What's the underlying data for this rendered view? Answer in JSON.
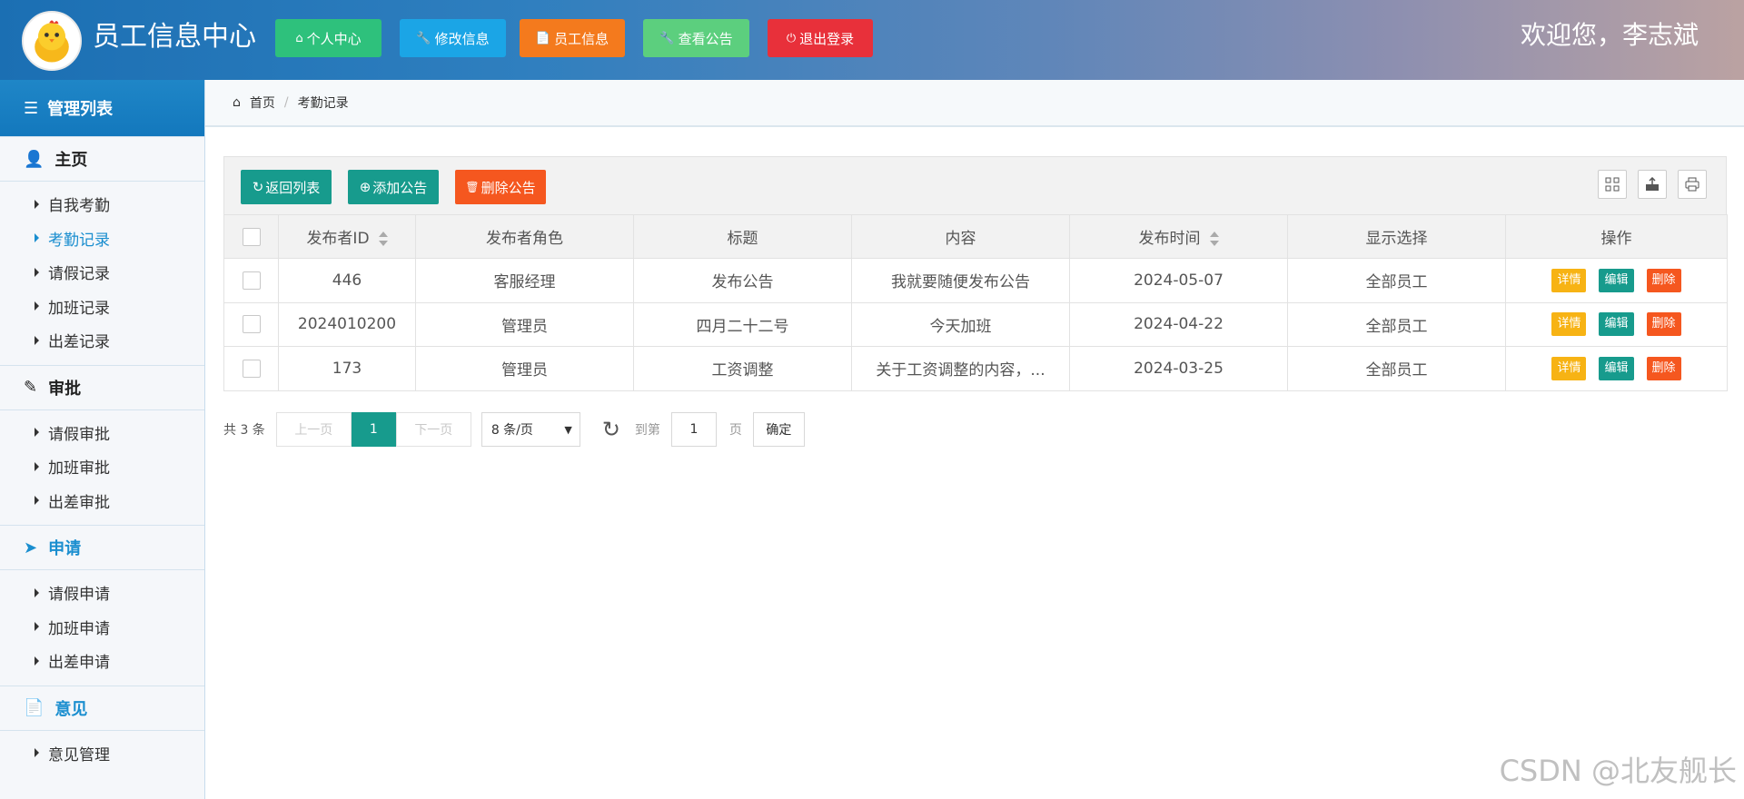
{
  "header": {
    "app_title": "员工信息中心",
    "welcome": "欢迎您，李志斌",
    "buttons": [
      {
        "label": "个人中心",
        "color": "#2ec17c",
        "icon": "home-icon"
      },
      {
        "label": "修改信息",
        "color": "#1ba5e6",
        "icon": "wrench-icon"
      },
      {
        "label": "员工信息",
        "color": "#f47a1d",
        "icon": "document-icon"
      },
      {
        "label": "查看公告",
        "color": "#5ccf7e",
        "icon": "wrench-icon"
      },
      {
        "label": "退出登录",
        "color": "#e8303a",
        "icon": "power-icon"
      }
    ]
  },
  "sidebar": {
    "title": "管理列表",
    "sections": [
      {
        "label": "主页",
        "icon": "user-icon",
        "items": [
          "自我考勤",
          "考勤记录",
          "请假记录",
          "加班记录",
          "出差记录"
        ],
        "active": "考勤记录"
      },
      {
        "label": "审批",
        "icon": "edit-icon",
        "items": [
          "请假审批",
          "加班审批",
          "出差审批"
        ]
      },
      {
        "label": "申请",
        "icon": "circle-arrow-icon",
        "items": [
          "请假申请",
          "加班申请",
          "出差申请"
        ]
      },
      {
        "label": "意见",
        "icon": "file-icon",
        "items": [
          "意见管理"
        ]
      }
    ]
  },
  "breadcrumb": {
    "home": "首页",
    "current": "考勤记录"
  },
  "toolbar": {
    "back": "返回列表",
    "add": "添加公告",
    "delete": "删除公告"
  },
  "table": {
    "columns": [
      "发布者ID",
      "发布者角色",
      "标题",
      "内容",
      "发布时间",
      "显示选择",
      "操作"
    ],
    "rows": [
      {
        "id": "446",
        "role": "客服经理",
        "title": "发布公告",
        "content": "我就要随便发布公告",
        "time": "2024-05-07",
        "scope": "全部员工"
      },
      {
        "id": "2024010200",
        "role": "管理员",
        "title": "四月二十二号",
        "content": "今天加班",
        "time": "2024-04-22",
        "scope": "全部员工"
      },
      {
        "id": "173",
        "role": "管理员",
        "title": "工资调整",
        "content": "关于工资调整的内容，...",
        "time": "2024-03-25",
        "scope": "全部员工"
      }
    ],
    "actions": {
      "detail": "详情",
      "edit": "编辑",
      "delete": "删除"
    }
  },
  "pager": {
    "total": "共 3 条",
    "prev": "上一页",
    "current": "1",
    "next": "下一页",
    "page_size": "8 条/页",
    "goto_prefix": "到第",
    "goto_value": "1",
    "goto_suffix": "页",
    "confirm": "确定"
  },
  "watermark": "CSDN @北友舰长",
  "colors": {
    "teal": "#179b8d",
    "orange": "#f5571f",
    "yellow": "#f7b314",
    "header_blue": "#1b6fb3"
  }
}
